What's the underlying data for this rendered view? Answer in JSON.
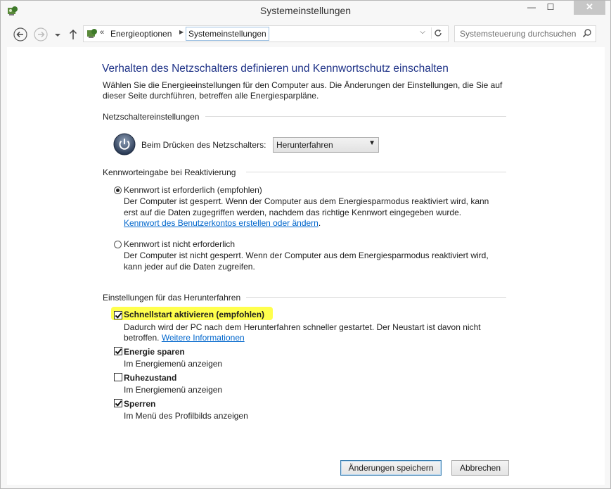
{
  "window": {
    "title": "Systemeinstellungen",
    "close_glyph": "✕",
    "minimize_glyph": "—",
    "maximize_glyph": "☐"
  },
  "nav": {
    "breadcrumb": [
      "Energieoptionen",
      "Systemeinstellungen"
    ],
    "breadcrumb_prefix": "«",
    "search_placeholder": "Systemsteuerung durchsuchen"
  },
  "page": {
    "title": "Verhalten des Netzschalters definieren und Kennwortschutz einschalten",
    "intro": "Wählen Sie die Energieeinstellungen für den Computer aus. Die Änderungen der Einstellungen, die Sie auf dieser Seite durchführen, betreffen alle Energiesparpläne."
  },
  "power_section": {
    "heading": "Netzschaltereinstellungen",
    "label": "Beim Drücken des Netzschalters:",
    "selected": "Herunterfahren"
  },
  "password_section": {
    "heading": "Kennworteingabe bei Reaktivierung",
    "options": [
      {
        "label": "Kennwort ist erforderlich (empfohlen)",
        "selected": true,
        "description": "Der Computer ist gesperrt. Wenn der Computer aus dem Energiesparmodus reaktiviert wird, kann erst auf die Daten zugegriffen werden, nachdem das richtige Kennwort eingegeben wurde.",
        "link": "Kennwort des Benutzerkontos erstellen oder ändern",
        "link_suffix": "."
      },
      {
        "label": "Kennwort ist nicht erforderlich",
        "selected": false,
        "description": "Der Computer ist nicht gesperrt. Wenn der Computer aus dem Energiesparmodus reaktiviert wird, kann jeder auf die Daten zugreifen."
      }
    ]
  },
  "shutdown_section": {
    "heading": "Einstellungen für das Herunterfahren",
    "items": [
      {
        "label": "Schnellstart aktivieren (empfohlen)",
        "checked": true,
        "highlighted": true,
        "description": "Dadurch wird der PC nach dem Herunterfahren schneller gestartet. Der Neustart ist davon nicht betroffen.",
        "link": "Weitere Informationen"
      },
      {
        "label": "Energie sparen",
        "checked": true,
        "description": "Im Energiemenü anzeigen"
      },
      {
        "label": "Ruhezustand",
        "checked": false,
        "description": "Im Energiemenü anzeigen"
      },
      {
        "label": "Sperren",
        "checked": true,
        "description": "Im Menü des Profilbilds anzeigen"
      }
    ]
  },
  "buttons": {
    "save": "Änderungen speichern",
    "cancel": "Abbrechen"
  },
  "colors": {
    "title": "#1e3287",
    "link": "#0066cc",
    "highlight": "#ffff4d"
  }
}
